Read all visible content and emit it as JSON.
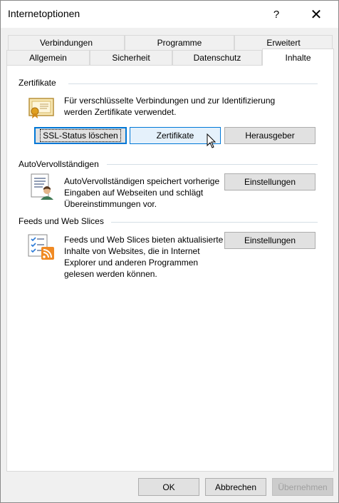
{
  "window": {
    "title": "Internetoptionen",
    "help_glyph": "?",
    "close_glyph": "✕"
  },
  "tabs_row1": [
    "Verbindungen",
    "Programme",
    "Erweitert"
  ],
  "tabs_row2": [
    "Allgemein",
    "Sicherheit",
    "Datenschutz",
    "Inhalte"
  ],
  "active_tab": "Inhalte",
  "zertifikate": {
    "title": "Zertifikate",
    "description": "Für verschlüsselte Verbindungen und zur Identifizierung werden Zertifikate verwendet.",
    "ssl_button": "SSL-Status löschen",
    "zert_button": "Zertifikate",
    "herausgeber_button": "Herausgeber",
    "icon": "certificate-icon"
  },
  "autovervoll": {
    "title": "AutoVervollständigen",
    "description": "AutoVervollständigen speichert vorherige Eingaben auf Webseiten und schlägt Übereinstimmungen vor.",
    "settings_button": "Einstellungen",
    "icon": "autocomplete-icon"
  },
  "feeds": {
    "title": "Feeds und Web Slices",
    "description": "Feeds und Web Slices bieten aktualisierte Inhalte von Websites, die in Internet Explorer und anderen Programmen gelesen werden können.",
    "settings_button": "Einstellungen",
    "icon": "rss-feed-icon"
  },
  "footer": {
    "ok": "OK",
    "cancel": "Abbrechen",
    "apply": "Übernehmen"
  },
  "colors": {
    "accent": "#0078d7",
    "hover_bg": "#e5f1fb",
    "button_bg": "#e1e1e1",
    "disabled_text": "#a0a0a0"
  }
}
